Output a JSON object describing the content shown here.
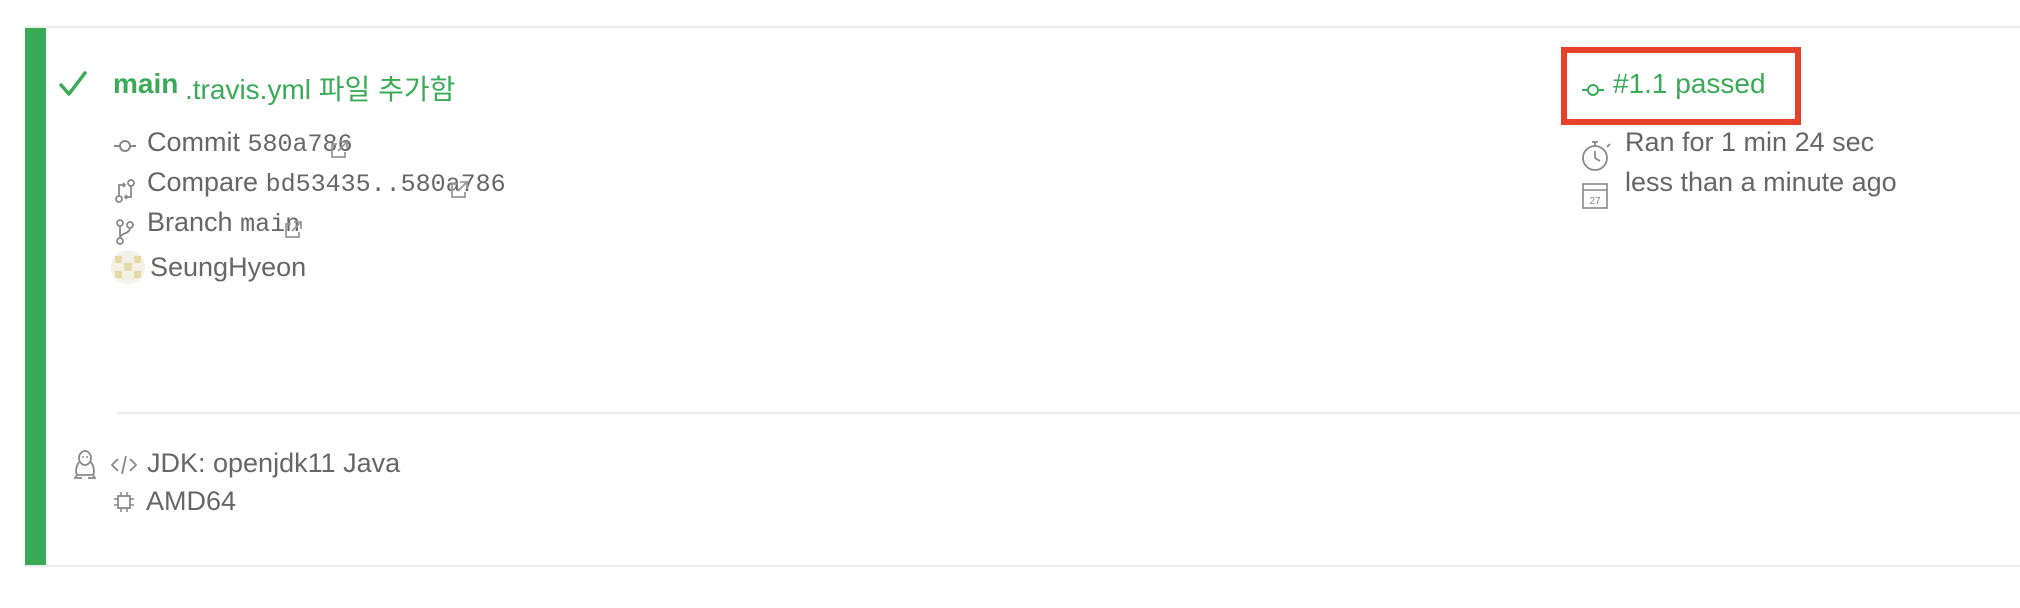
{
  "build": {
    "branch_label": "main",
    "commit_message": ".travis.yml 파일 추가함",
    "commit_label": "Commit",
    "commit_sha": "580a786",
    "compare_label": "Compare",
    "compare_range": "bd53435..580a786",
    "branch_row_label": "Branch",
    "branch_name": "main",
    "author": "SeungHyeon"
  },
  "status": {
    "job": "#1.1 passed",
    "duration": "Ran for 1 min 24 sec",
    "finished": "less than a minute ago",
    "calendar_day": "27"
  },
  "config": {
    "language": "JDK: openjdk11 Java",
    "arch": "AMD64"
  },
  "colors": {
    "passed": "#39aa56",
    "highlight": "#e8412a"
  }
}
